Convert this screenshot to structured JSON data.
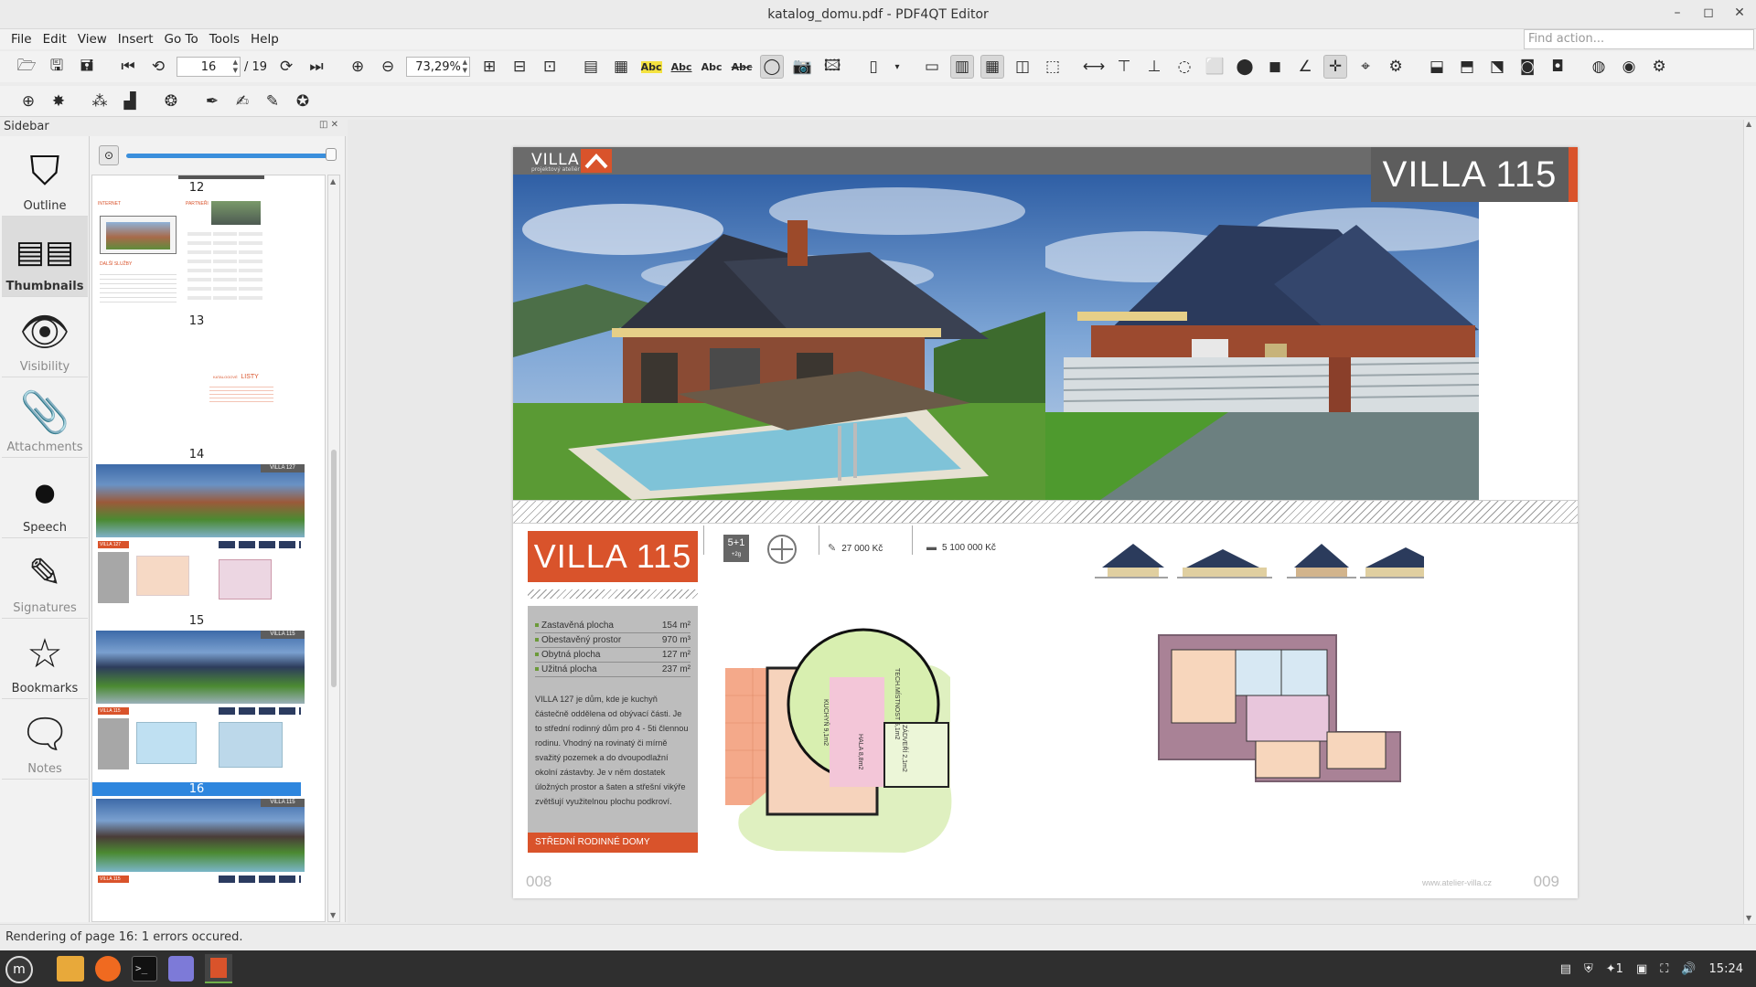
{
  "window": {
    "title": "katalog_domu.pdf - PDF4QT Editor",
    "controls": [
      "–",
      "◻",
      "✕"
    ]
  },
  "menu": [
    "File",
    "Edit",
    "View",
    "Insert",
    "Go To",
    "Tools",
    "Help"
  ],
  "find_action_placeholder": "Find action...",
  "toolbar": {
    "page_current": "16",
    "page_total": "/ 19",
    "zoom": "73,29%",
    "abc_labels": [
      "Abc",
      "Abc",
      "Abc",
      "Abc"
    ]
  },
  "sidebar": {
    "title": "Sidebar",
    "tabs": [
      {
        "label": "Outline",
        "icon": "bookmark-outline-icon",
        "selected": false,
        "enabled": true
      },
      {
        "label": "Thumbnails",
        "icon": "thumbnails-icon",
        "selected": true,
        "enabled": true
      },
      {
        "label": "Visibility",
        "icon": "eye-icon",
        "selected": false,
        "enabled": false
      },
      {
        "label": "Attachments",
        "icon": "paperclip-icon",
        "selected": false,
        "enabled": false
      },
      {
        "label": "Speech",
        "icon": "speech-icon",
        "selected": false,
        "enabled": true
      },
      {
        "label": "Signatures",
        "icon": "signature-pen-icon",
        "selected": false,
        "enabled": false
      },
      {
        "label": "Bookmarks",
        "icon": "star-icon",
        "selected": false,
        "enabled": true
      },
      {
        "label": "Notes",
        "icon": "notes-icon",
        "selected": false,
        "enabled": false
      }
    ],
    "thumbnails": [
      {
        "page": "12",
        "selected": false
      },
      {
        "page": "13",
        "selected": false
      },
      {
        "page": "14",
        "selected": false
      },
      {
        "page": "15",
        "selected": false
      },
      {
        "page": "16",
        "selected": true
      }
    ],
    "thumb_texts": {
      "t12_heading_a": "INTERNET",
      "t12_heading_b": "PARTNEŘI",
      "t12_heading_c": "DALŠÍ SLUŽBY",
      "t13_title_small": "KATALOGOVÉ",
      "t13_title": "LISTY",
      "t14_banner": "VILLA 127",
      "t15_banner": "VILLA 115",
      "t16_banner": "VILLA 115",
      "t14_box": "VILLA 127",
      "t15_box": "VILLA 115",
      "t16_box": "VILLA 115"
    }
  },
  "document": {
    "logo_text": "VILLA",
    "logo_sub": "projektový ateliér",
    "title_banner": "VILLA 115",
    "villa_box": "VILLA 115",
    "rooms": "5+1",
    "rooms_sub": "+2g",
    "price1": "27 000 Kč",
    "price2": "5 100 000 Kč",
    "areas": [
      {
        "label": "Zastavěná plocha",
        "value": "154 m²"
      },
      {
        "label": "Obestavěný prostor",
        "value": "970 m³"
      },
      {
        "label": "Obytná plocha",
        "value": "127 m²"
      },
      {
        "label": "Užitná plocha",
        "value": "237 m²"
      }
    ],
    "description": "VILLA 127 je dům, kde je kuchyň částečně oddělena od obývací části. Je to střední rodinný dům pro 4 - 5ti člennou rodinu. Vhodný na rovinatý či mírně svažitý pozemek a do dvoupodlažní okolní zástavby. Je v něm dostatek úložných prostor a šaten a střešní vikýře zvětšují využitelnou plochu podkroví.",
    "category": "STŘEDNÍ RODINNÉ DOMY",
    "page_left": "008",
    "page_right": "009",
    "website": "www.atelier-villa.cz",
    "plan_labels": {
      "kitchen": "KUCHYŇ 9,1m2",
      "tech": "TECH.MÍSTNOST 5,1m2",
      "hall": "HALA 8,8m2",
      "entry": "ZÁDVEŘÍ 2,1m2"
    }
  },
  "status_bar": "Rendering of page 16: 1 errors occured.",
  "taskbar": {
    "clock": "15:24",
    "tray_count": "1",
    "apps": [
      "mint-menu-icon",
      "files-icon",
      "firefox-icon",
      "terminal-icon",
      "text-editor-icon",
      "pdf4qt-icon"
    ]
  },
  "colors": {
    "accent": "#d9532b",
    "selection_blue": "#2e86de",
    "taskbar": "#2f2f2f"
  }
}
